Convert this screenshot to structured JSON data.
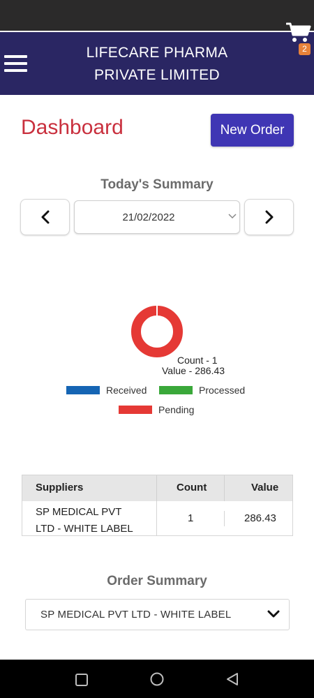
{
  "header": {
    "title_line1": "LIFECARE PHARMA",
    "title_line2": "PRIVATE LIMITED",
    "menu_icon": "hamburger-menu-icon",
    "cart_icon": "shopping-cart-icon",
    "cart_count": "2"
  },
  "dashboard": {
    "title": "Dashboard",
    "new_order_label": "New Order"
  },
  "summary": {
    "title": "Today's Summary",
    "date": "21/02/2022",
    "prev_icon": "chevron-left-icon",
    "next_icon": "chevron-right-icon"
  },
  "chart_data": {
    "type": "pie",
    "slices": [
      {
        "label": "Received",
        "count": 0,
        "color": "#1565b4"
      },
      {
        "label": "Processed",
        "count": 0,
        "color": "#3aa83a"
      },
      {
        "label": "Pending",
        "count": 1,
        "value": 286.43,
        "color": "#e53935"
      }
    ],
    "annotation_count": "Count - 1",
    "annotation_value": "Value - 286.43",
    "legend": [
      "Received",
      "Processed",
      "Pending"
    ]
  },
  "suppliers_table": {
    "headers": {
      "supplier": "Suppliers",
      "count": "Count",
      "value": "Value"
    },
    "rows": [
      {
        "supplier_line1": "SP MEDICAL PVT",
        "supplier_line2": "LTD - WHITE LABEL",
        "count": "1",
        "value": "286.43"
      }
    ]
  },
  "order_summary": {
    "title": "Order Summary",
    "selected_supplier": "SP MEDICAL PVT LTD - WHITE LABEL"
  },
  "system_nav": {
    "icons": [
      "recent-apps-icon",
      "home-icon",
      "back-icon"
    ]
  },
  "colors": {
    "header_bg": "#2a2663",
    "accent_red": "#c9303e",
    "button_bg": "#3f36b4",
    "badge": "#e8823a"
  }
}
